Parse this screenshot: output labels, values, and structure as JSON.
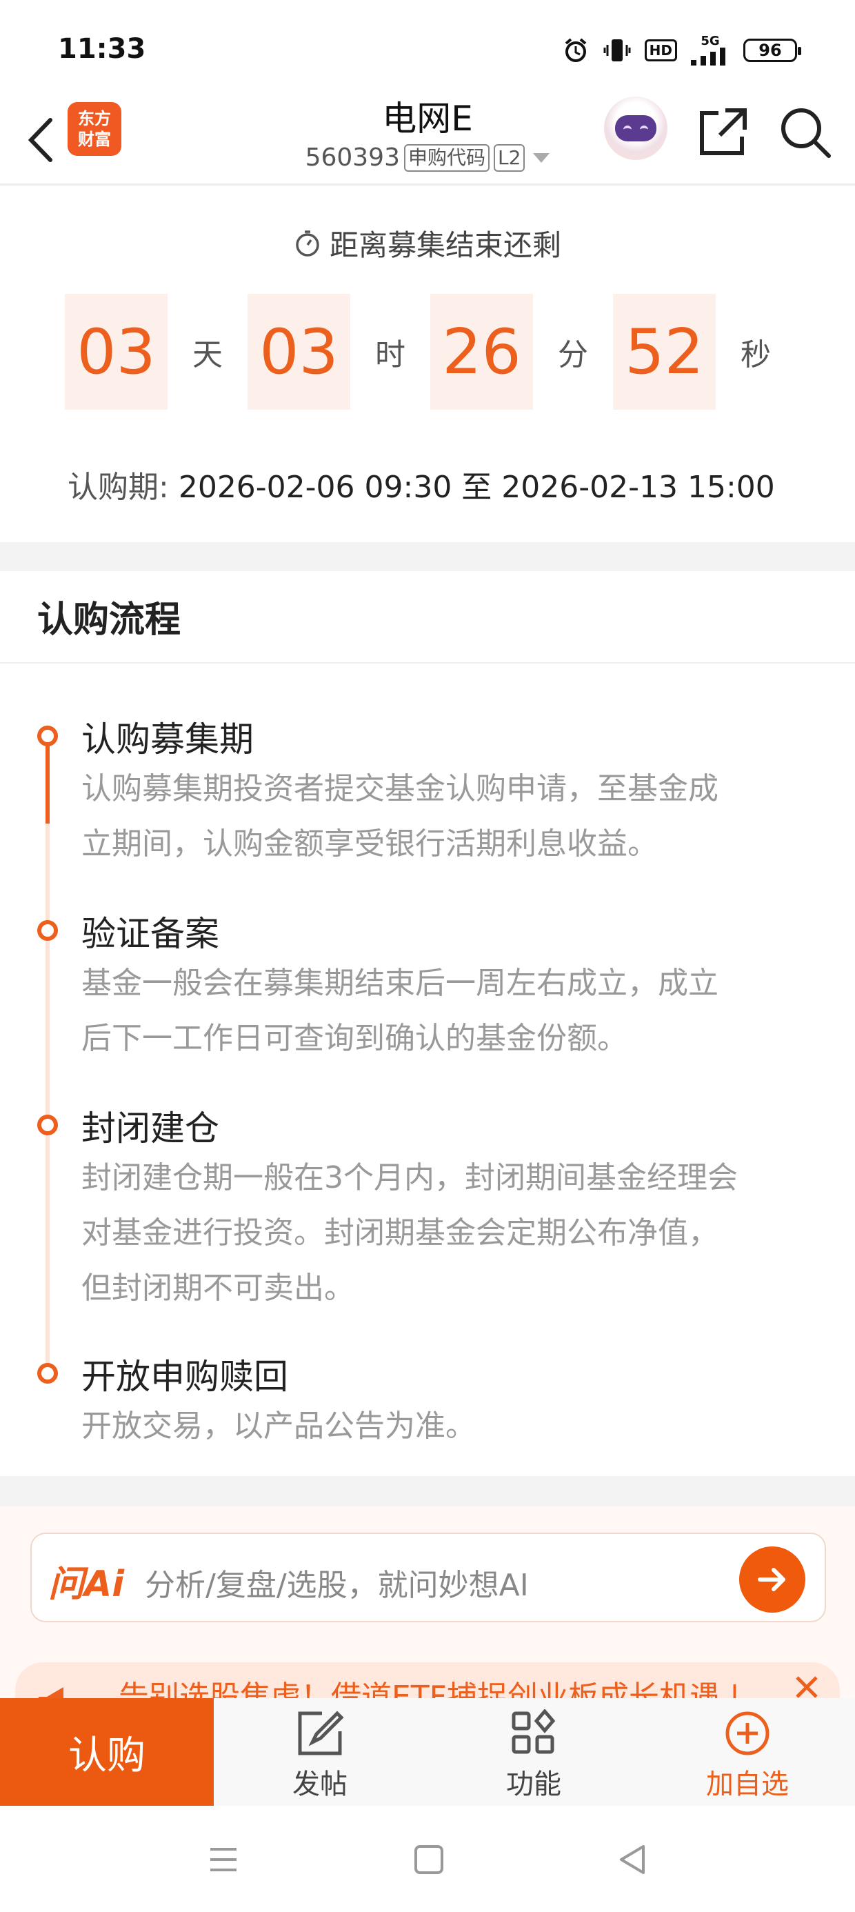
{
  "status_bar": {
    "time": "11:33",
    "hd": "HD",
    "network": "5G",
    "battery": "96"
  },
  "header": {
    "logo_line1": "东方",
    "logo_line2": "财富",
    "title": "电网E",
    "code": "560393",
    "tag_purchase_code": "申购代码",
    "tag_level": "L2"
  },
  "countdown": {
    "title": "距离募集结束还剩",
    "days": "03",
    "days_unit": "天",
    "hours": "03",
    "hours_unit": "时",
    "minutes": "26",
    "minutes_unit": "分",
    "seconds": "52",
    "seconds_unit": "秒",
    "period_label": "认购期:",
    "period_value": "2026-02-06 09:30 至 2026-02-13 15:00"
  },
  "process": {
    "title": "认购流程",
    "steps": [
      {
        "title": "认购募集期",
        "desc_line1": "认购募集期投资者提交基金认购申请，至基金成",
        "desc_line2": "立期间，认购金额享受银行活期利息收益。"
      },
      {
        "title": "验证备案",
        "desc_line1": "基金一般会在募集期结束后一周左右成立，成立",
        "desc_line2": "后下一工作日可查询到确认的基金份额。"
      },
      {
        "title": "封闭建仓",
        "desc_line1": "封闭建仓期一般在3个月内，封闭期间基金经理会",
        "desc_line2": "对基金进行投资。封闭期基金会定期公布净值，",
        "desc_line3": "但封闭期不可卖出。"
      },
      {
        "title": "开放申购赎回",
        "desc_line1": "开放交易，以产品公告为准。"
      }
    ]
  },
  "ai": {
    "logo": "问Ai",
    "placeholder": "分析/复盘/选股，就问妙想AI",
    "banner_text": "告别选股焦虑！借道ETF捕捉创业板成长机遇 |"
  },
  "actions": {
    "subscribe": "认购",
    "post": "发帖",
    "functions": "功能",
    "add_watchlist": "加自选"
  },
  "colors": {
    "accent": "#ec5f1d",
    "countdown_bg": "#fdf0ea"
  }
}
